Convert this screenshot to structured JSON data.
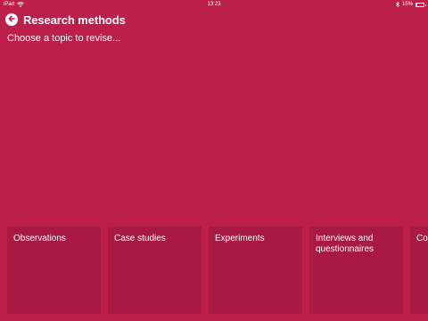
{
  "status_bar": {
    "device": "iPad",
    "time": "13:23",
    "battery_text": "15%"
  },
  "header": {
    "title": "Research methods",
    "back_icon": "back-arrow-circle-icon"
  },
  "subtitle": "Choose a topic to revise...",
  "topics": [
    {
      "label": "Observations"
    },
    {
      "label": "Case studies"
    },
    {
      "label": "Experiments"
    },
    {
      "label": "Interviews and questionnaires"
    },
    {
      "label": "Co"
    }
  ],
  "colors": {
    "background": "#bc1f4a",
    "tile": "#a81a42",
    "text": "#ffffff"
  }
}
